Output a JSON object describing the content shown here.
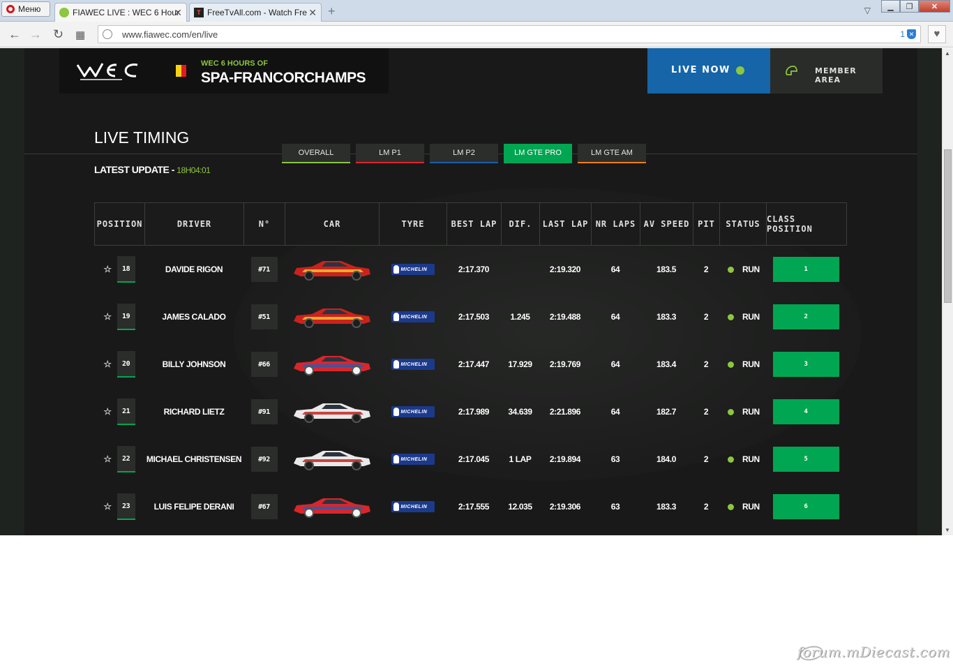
{
  "browser": {
    "menu_label": "Меню",
    "tabs": [
      {
        "title": "FIAWEC LIVE : WEC 6 Hour"
      },
      {
        "title": "FreeTvAll.com - Watch Fre"
      }
    ],
    "url": "www.fiawec.com/en/live",
    "blocked_count": "1"
  },
  "header": {
    "event_subtitle": "WEC 6 HOURS OF",
    "event_title": "SPA-FRANCORCHAMPS",
    "live_now": "LIVE NOW",
    "member_area": "MEMBER AREA",
    "flag_colors": [
      "#111111",
      "#f5d312",
      "#e21b22"
    ]
  },
  "timing": {
    "title": "LIVE TIMING",
    "update_label": "LATEST UPDATE - ",
    "update_time": "18H04:01",
    "categories": [
      {
        "label": "OVERALL",
        "color": "#8dc63f",
        "active": false
      },
      {
        "label": "LM P1",
        "color": "#e0242b",
        "active": false
      },
      {
        "label": "LM P2",
        "color": "#1a5fab",
        "active": false
      },
      {
        "label": "LM GTE PRO",
        "color": "#00a651",
        "active": true
      },
      {
        "label": "LM GTE AM",
        "color": "#f07d1b",
        "active": false
      }
    ],
    "columns": [
      "POSITION",
      "DRIVER",
      "N°",
      "CAR",
      "TYRE",
      "BEST LAP",
      "DIF.",
      "LAST LAP",
      "NR LAPS",
      "AV SPEED",
      "PIT",
      "STATUS",
      "CLASS POSITION"
    ],
    "tyre_brand": "MICHELIN",
    "rows": [
      {
        "position": "18",
        "driver": "DAVIDE RIGON",
        "number": "#71",
        "car": "ferrari",
        "best_lap": "2:17.370",
        "dif": "",
        "last_lap": "2:19.320",
        "nr_laps": "64",
        "av_speed": "183.5",
        "pit": "2",
        "status": "RUN",
        "class_position": "1"
      },
      {
        "position": "19",
        "driver": "JAMES CALADO",
        "number": "#51",
        "car": "ferrari",
        "best_lap": "2:17.503",
        "dif": "1.245",
        "last_lap": "2:19.488",
        "nr_laps": "64",
        "av_speed": "183.3",
        "pit": "2",
        "status": "RUN",
        "class_position": "2"
      },
      {
        "position": "20",
        "driver": "BILLY JOHNSON",
        "number": "#66",
        "car": "ford",
        "best_lap": "2:17.447",
        "dif": "17.929",
        "last_lap": "2:19.769",
        "nr_laps": "64",
        "av_speed": "183.4",
        "pit": "2",
        "status": "RUN",
        "class_position": "3"
      },
      {
        "position": "21",
        "driver": "RICHARD LIETZ",
        "number": "#91",
        "car": "porsche",
        "best_lap": "2:17.989",
        "dif": "34.639",
        "last_lap": "2:21.896",
        "nr_laps": "64",
        "av_speed": "182.7",
        "pit": "2",
        "status": "RUN",
        "class_position": "4"
      },
      {
        "position": "22",
        "driver": "MICHAEL CHRISTENSEN",
        "number": "#92",
        "car": "porsche",
        "best_lap": "2:17.045",
        "dif": "1 LAP",
        "last_lap": "2:19.894",
        "nr_laps": "63",
        "av_speed": "184.0",
        "pit": "2",
        "status": "RUN",
        "class_position": "5"
      },
      {
        "position": "23",
        "driver": "LUIS FELIPE DERANI",
        "number": "#67",
        "car": "ford",
        "best_lap": "2:17.555",
        "dif": "12.035",
        "last_lap": "2:19.306",
        "nr_laps": "63",
        "av_speed": "183.3",
        "pit": "2",
        "status": "RUN",
        "class_position": "6"
      }
    ]
  },
  "watermark": "forum.mDiecast.com"
}
